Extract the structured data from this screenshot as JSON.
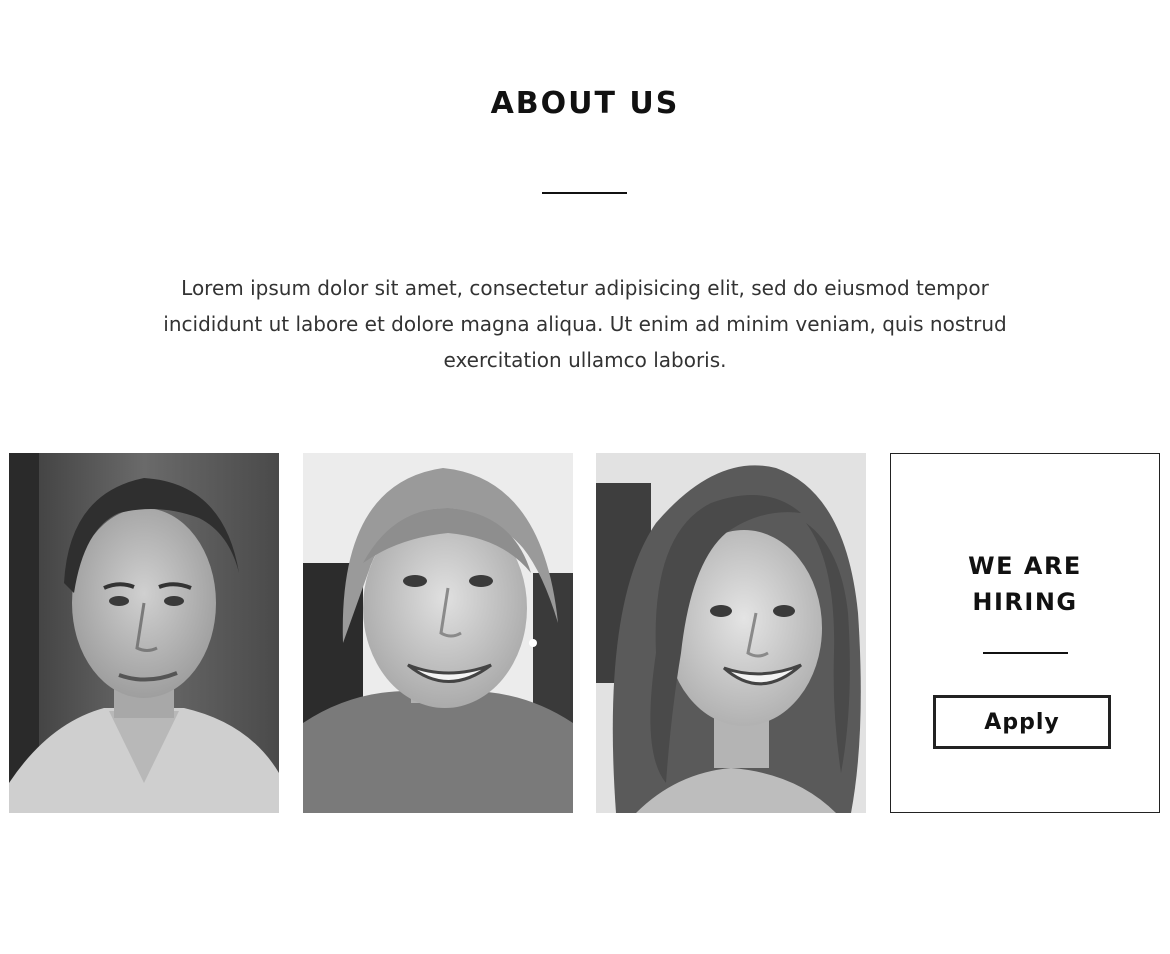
{
  "about": {
    "title": "ABOUT US",
    "intro": "Lorem ipsum dolor sit amet, consectetur adipisicing elit, sed do eiusmod tempor incididunt ut labore et dolore magna aliqua. Ut enim ad minim veniam, quis nostrud exercitation ullamco laboris."
  },
  "team": [
    {
      "photo": "man-portrait-grayscale"
    },
    {
      "photo": "woman-blonde-portrait-grayscale"
    },
    {
      "photo": "woman-brunette-portrait-grayscale"
    }
  ],
  "hiring": {
    "title_line1": "WE ARE",
    "title_line2": "HIRING",
    "apply_label": "Apply"
  },
  "colors": {
    "text": "#111111",
    "background": "#ffffff",
    "border": "#222222"
  }
}
